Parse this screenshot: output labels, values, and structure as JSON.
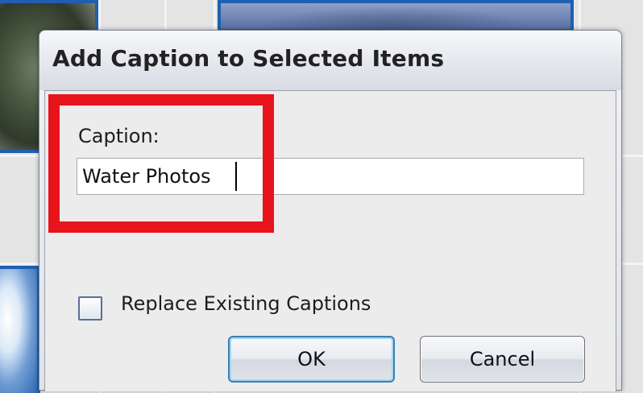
{
  "dialog": {
    "title": "Add Caption to Selected Items",
    "caption_label": "Caption:",
    "caption_value": "Water Photos",
    "replace_label": "Replace Existing Captions",
    "replace_checked": false,
    "ok_label": "OK",
    "cancel_label": "Cancel"
  },
  "colors": {
    "highlight": "#e8141b",
    "thumbnail_border": "#1e5fb0",
    "ok_focus": "#3c7fb1"
  }
}
